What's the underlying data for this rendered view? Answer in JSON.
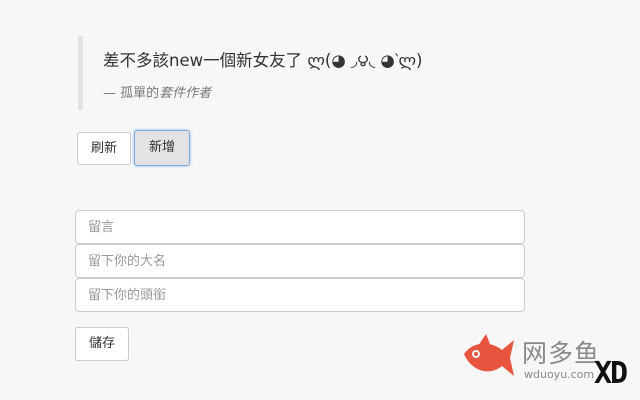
{
  "quote": {
    "text": "差不多該new一個新女友了 ლ(◕ ◞౪◟ ◕‵ლ)",
    "author_prefix": "— 孤單的",
    "author_name": "套件作者"
  },
  "toolbar": {
    "refresh_label": "刷新",
    "add_label": "新增"
  },
  "form": {
    "message_placeholder": "留言",
    "name_placeholder": "留下你的大名",
    "title_placeholder": "留下你的頭銜",
    "message_value": "",
    "name_value": "",
    "title_value": "",
    "save_label": "儲存"
  },
  "watermark": {
    "site_name": "网多鱼",
    "site_url": "wduoyu.com",
    "badge": "XD",
    "fish_color": "#e8553e"
  }
}
